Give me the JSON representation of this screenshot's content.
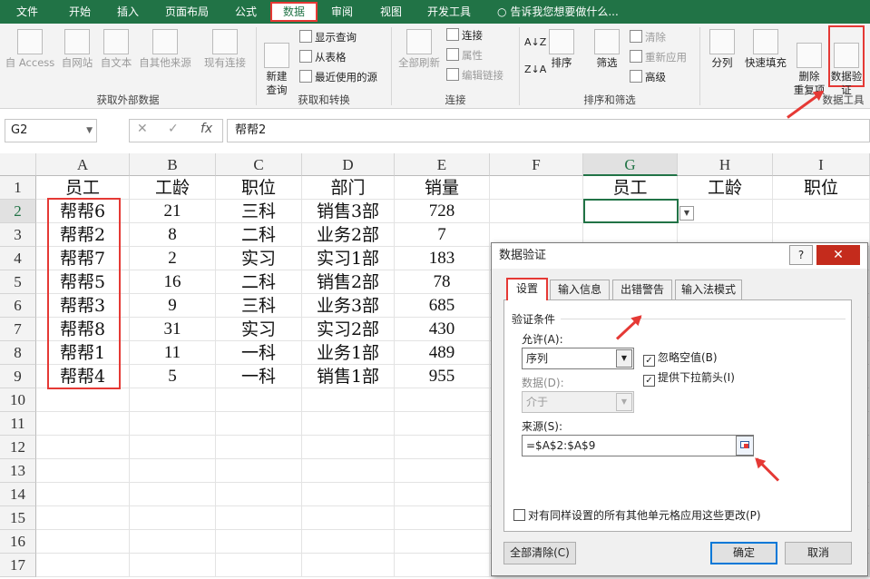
{
  "tabs": [
    "文件",
    "开始",
    "插入",
    "页面布局",
    "公式",
    "数据",
    "审阅",
    "视图",
    "开发工具"
  ],
  "active_tab": "数据",
  "tell_me": "告诉我您想要做什么...",
  "ribbon": {
    "external": {
      "access": "自 Access",
      "web": "自网站",
      "text": "自文本",
      "other": "自其他来源",
      "existing": "现有连接",
      "label": "获取外部数据"
    },
    "transform": {
      "new_query": "新建\n查询",
      "show_query": "显示查询",
      "from_table": "从表格",
      "recent": "最近使用的源",
      "label": "获取和转换"
    },
    "connections": {
      "refresh_all": "全部刷新",
      "connections": "连接",
      "properties": "属性",
      "edit_links": "编辑链接",
      "label": "连接"
    },
    "sort": {
      "sort": "排序",
      "filter": "筛选",
      "clear": "清除",
      "reapply": "重新应用",
      "advanced": "高级",
      "label": "排序和筛选"
    },
    "tools": {
      "split": "分列",
      "flash_fill": "快速填充",
      "remove_dup": "删除\n重复项",
      "validation": "数据验\n证",
      "label": "数据工具"
    }
  },
  "formula_bar": {
    "name_box": "G2",
    "content": "帮帮2"
  },
  "columns": [
    "A",
    "B",
    "C",
    "D",
    "E",
    "F",
    "G",
    "H",
    "I"
  ],
  "rows": [
    "1",
    "2",
    "3",
    "4",
    "5",
    "6",
    "7",
    "8",
    "9",
    "10",
    "11",
    "12",
    "13",
    "14",
    "15",
    "16",
    "17"
  ],
  "sheet": {
    "header": [
      "员工",
      "工龄",
      "职位",
      "部门",
      "销量"
    ],
    "data": [
      [
        "帮帮6",
        "21",
        "三科",
        "销售3部",
        "728"
      ],
      [
        "帮帮2",
        "8",
        "二科",
        "业务2部",
        "7"
      ],
      [
        "帮帮7",
        "2",
        "实习",
        "实习1部",
        "183"
      ],
      [
        "帮帮5",
        "16",
        "二科",
        "销售2部",
        "78"
      ],
      [
        "帮帮3",
        "9",
        "三科",
        "业务3部",
        "685"
      ],
      [
        "帮帮8",
        "31",
        "实习",
        "实习2部",
        "430"
      ],
      [
        "帮帮1",
        "11",
        "一科",
        "业务1部",
        "489"
      ],
      [
        "帮帮4",
        "5",
        "一科",
        "销售1部",
        "955"
      ]
    ],
    "g_header": [
      "员工",
      "工龄",
      "职位"
    ]
  },
  "dialog": {
    "title": "数据验证",
    "help": "?",
    "close": "✕",
    "tabs": [
      "设置",
      "输入信息",
      "出错警告",
      "输入法模式"
    ],
    "criteria": "验证条件",
    "allow_label": "允许(A):",
    "allow_value": "序列",
    "ignore_blank": "忽略空值(B)",
    "dropdown": "提供下拉箭头(I)",
    "data_label": "数据(D):",
    "data_value": "介于",
    "source_label": "来源(S):",
    "source_value": "=$A$2:$A$9",
    "apply_all": "对有同样设置的所有其他单元格应用这些更改(P)",
    "clear_all": "全部清除(C)",
    "ok": "确定",
    "cancel": "取消"
  },
  "colors": {
    "excel_green": "#217346",
    "highlight": "#e53935"
  }
}
